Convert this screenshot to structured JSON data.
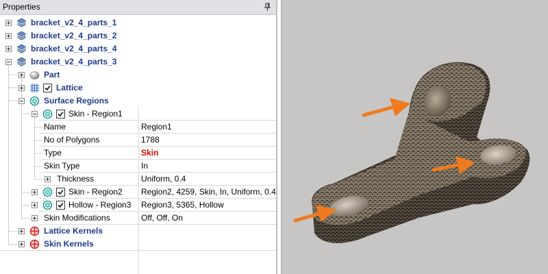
{
  "panel": {
    "title": "Properties",
    "pin_icon": "pin-icon"
  },
  "tree": {
    "parts": [
      {
        "label": "bracket_v2_4_parts_1"
      },
      {
        "label": "bracket_v2_4_parts_2"
      },
      {
        "label": "bracket_v2_4_parts_4"
      },
      {
        "label": "bracket_v2_4_parts_3"
      }
    ],
    "part": {
      "label": "Part"
    },
    "lattice": {
      "label": "Lattice"
    },
    "surface_regions": {
      "label": "Surface Regions"
    },
    "skin_region1": {
      "label": "Skin - Region1"
    },
    "properties": [
      {
        "name": "Name",
        "value": "Region1"
      },
      {
        "name": "No of Polygons",
        "value": "1788"
      },
      {
        "name": "Type",
        "value": "Skin",
        "value_color": "#e00000"
      },
      {
        "name": "Skin Type",
        "value": "In"
      },
      {
        "name": "Thickness",
        "value": "Uniform, 0.4"
      }
    ],
    "skin_region2": {
      "label": "Skin - Region2",
      "value": "Region2, 4259, Skin, In, Uniform, 0.4"
    },
    "hollow_region3": {
      "label": "Hollow - Region3",
      "value": "Region3, 5365, Hollow"
    },
    "skin_modifications": {
      "label": "Skin Modifications",
      "value": "Off, Off, On"
    },
    "lattice_kernels": {
      "label": "Lattice Kernels"
    },
    "skin_kernels": {
      "label": "Skin Kernels"
    }
  },
  "colors": {
    "node_text": "#1f3a8a",
    "accent_red": "#e00000",
    "viewport_bg": "#c7c6c4",
    "mesh": "#4b4238",
    "arrow": "#f07a1e"
  },
  "viewport": {
    "model": "bracket mesh",
    "arrows": [
      "arrow-upper-hole",
      "arrow-right-hole",
      "arrow-left-hole"
    ]
  }
}
